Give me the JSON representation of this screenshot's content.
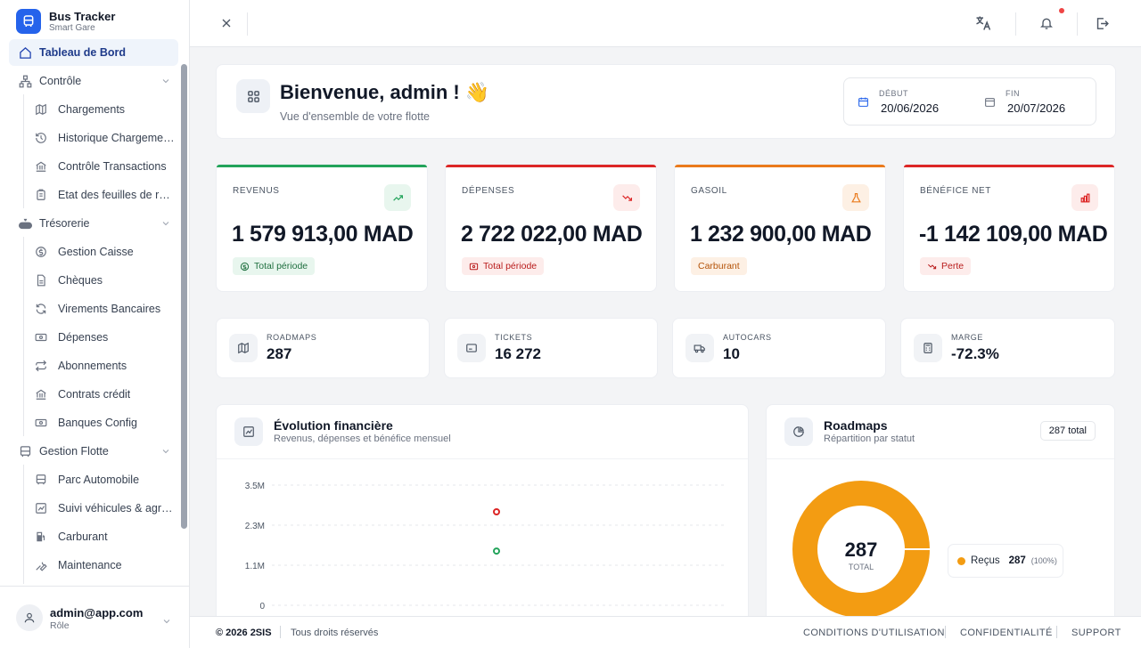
{
  "app": {
    "title": "Bus Tracker",
    "subtitle": "Smart Gare"
  },
  "sidebar": {
    "items": [
      {
        "label": "Tableau de Bord",
        "icon": "home-icon",
        "active": true
      },
      {
        "label": "Contrôle",
        "icon": "sitemap-icon",
        "expandable": true
      },
      {
        "label": "Chargements",
        "icon": "map-icon",
        "sub": true
      },
      {
        "label": "Historique Chargements",
        "icon": "history-icon",
        "sub": true
      },
      {
        "label": "Contrôle Transactions",
        "icon": "bank-icon",
        "sub": true
      },
      {
        "label": "Etat des feuilles de route",
        "icon": "clipboard-icon",
        "sub": true
      },
      {
        "label": "Trésorerie",
        "icon": "money-bag-icon",
        "expandable": true
      },
      {
        "label": "Gestion Caisse",
        "icon": "dollar-circle-icon",
        "sub": true
      },
      {
        "label": "Chèques",
        "icon": "document-icon",
        "sub": true
      },
      {
        "label": "Virements Bancaires",
        "icon": "refresh-icon",
        "sub": true
      },
      {
        "label": "Dépenses",
        "icon": "banknote-icon",
        "sub": true
      },
      {
        "label": "Abonnements",
        "icon": "repeat-icon",
        "sub": true
      },
      {
        "label": "Contrats crédit",
        "icon": "bank-icon",
        "sub": true
      },
      {
        "label": "Banques Config",
        "icon": "banknote-icon",
        "sub": true
      },
      {
        "label": "Gestion Flotte",
        "icon": "bus-icon",
        "expandable": true
      },
      {
        "label": "Parc Automobile",
        "icon": "bus-icon",
        "sub": true
      },
      {
        "label": "Suivi véhicules & agréments",
        "icon": "chart-icon",
        "sub": true
      },
      {
        "label": "Carburant",
        "icon": "fuel-icon",
        "sub": true
      },
      {
        "label": "Maintenance",
        "icon": "wrench-icon",
        "sub": true
      }
    ]
  },
  "user": {
    "email": "admin@app.com",
    "role": "Rôle"
  },
  "welcome": {
    "title": "Bienvenue, admin ! 👋",
    "subtitle": "Vue d'ensemble de votre flotte"
  },
  "daterange": {
    "start_label": "DÉBUT",
    "start_value": "20/06/2026",
    "end_label": "FIN",
    "end_value": "20/07/2026"
  },
  "stats": [
    {
      "label": "REVENUS",
      "value": "1 579 913,00 MAD",
      "badge": "Total période",
      "color": "#22a35a",
      "icon": "trending-up-icon"
    },
    {
      "label": "DÉPENSES",
      "value": "2 722 022,00 MAD",
      "badge": "Total période",
      "color": "#dc2626",
      "icon": "trending-down-icon"
    },
    {
      "label": "GASOIL",
      "value": "1 232 900,00 MAD",
      "badge": "Carburant",
      "color": "#ea7a1c",
      "icon": "flask-icon"
    },
    {
      "label": "BÉNÉFICE NET",
      "value": "-1 142 109,00 MAD",
      "badge": "Perte",
      "color": "#dc2626",
      "icon": "bar-chart-icon"
    }
  ],
  "minis": [
    {
      "label": "ROADMAPS",
      "value": "287",
      "icon": "map-icon"
    },
    {
      "label": "TICKETS",
      "value": "16 272",
      "icon": "ticket-icon"
    },
    {
      "label": "AUTOCARS",
      "value": "10",
      "icon": "truck-icon"
    },
    {
      "label": "MARGE",
      "value": "-72.3%",
      "icon": "calculator-icon"
    }
  ],
  "evolution": {
    "title": "Évolution financière",
    "subtitle": "Revenus, dépenses et bénéfice mensuel"
  },
  "roadmaps": {
    "title": "Roadmaps",
    "subtitle": "Répartition par statut",
    "total_badge": "287 total",
    "center_value": "287",
    "center_label": "TOTAL"
  },
  "chart_data": [
    {
      "type": "scatter",
      "title": "Évolution financière",
      "y_ticks": [
        "3.5M",
        "2.3M",
        "1.1M",
        "0"
      ],
      "ylim": [
        0,
        3500000
      ],
      "series": [
        {
          "values": [
            2722022
          ],
          "color": "#dc2626"
        },
        {
          "values": [
            1579913
          ],
          "color": "#22a35a"
        }
      ]
    },
    {
      "type": "pie",
      "title": "Roadmaps",
      "slices": [
        {
          "label": "Reçus",
          "value": 287,
          "percent": "(100%)",
          "color": "#f39c12"
        }
      ]
    }
  ],
  "footer": {
    "copyright": "© 2026 2SIS",
    "rights": "Tous droits réservés",
    "links": [
      "CONDITIONS D'UTILISATION",
      "CONFIDENTIALITÉ",
      "SUPPORT"
    ]
  }
}
